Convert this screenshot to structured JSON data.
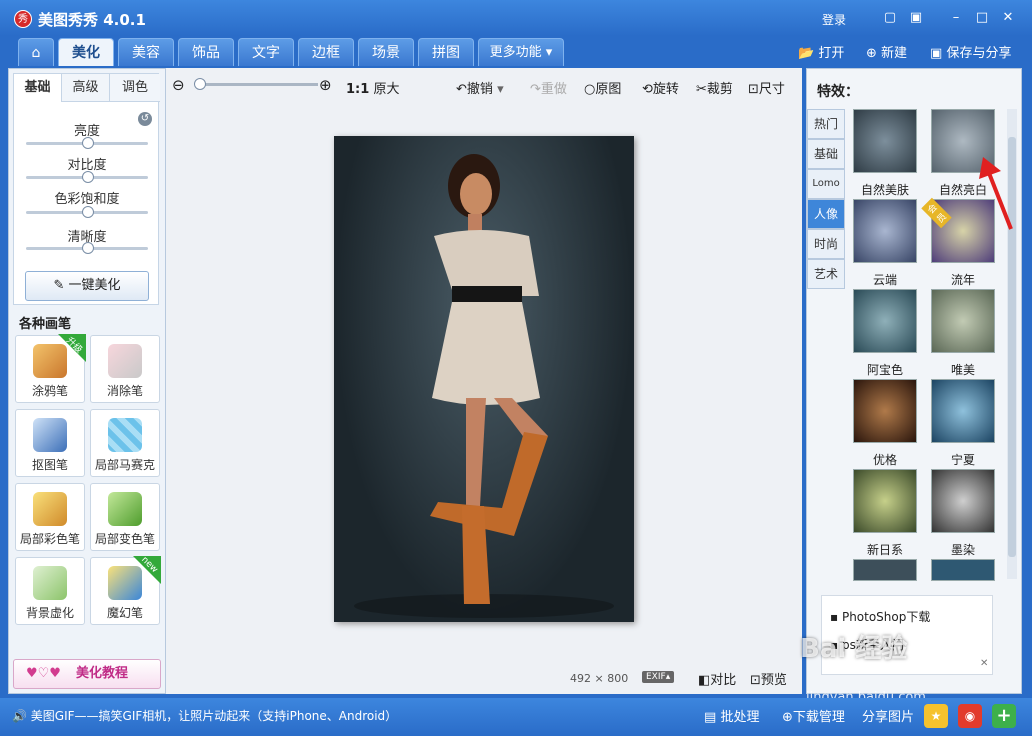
{
  "app": {
    "title": "美图秀秀 4.0.1",
    "logo_text": "秀",
    "login": "登录"
  },
  "tabs": [
    "美化",
    "美容",
    "饰品",
    "文字",
    "边框",
    "场景",
    "拼图",
    "更多功能"
  ],
  "file_actions": {
    "open": "打开",
    "new": "新建",
    "save_share": "保存与分享"
  },
  "adjust": {
    "subtabs": [
      "基础",
      "高级",
      "调色"
    ],
    "sliders": [
      "亮度",
      "对比度",
      "色彩饱和度",
      "清晰度"
    ],
    "onekey": "一键美化"
  },
  "brushes": {
    "title": "各种画笔",
    "items": [
      {
        "label": "涂鸦笔",
        "badge": "升级",
        "icon": "brush-icon"
      },
      {
        "label": "消除笔",
        "badge": "",
        "icon": "eraser-icon"
      },
      {
        "label": "抠图笔",
        "badge": "",
        "icon": "pen-icon"
      },
      {
        "label": "局部马赛克",
        "badge": "",
        "icon": "mosaic-icon"
      },
      {
        "label": "局部彩色笔",
        "badge": "",
        "icon": "color-brush-icon"
      },
      {
        "label": "局部变色笔",
        "badge": "",
        "icon": "recolor-icon"
      },
      {
        "label": "背景虚化",
        "badge": "",
        "icon": "blur-icon"
      },
      {
        "label": "魔幻笔",
        "badge": "new",
        "icon": "magic-pen-icon"
      }
    ]
  },
  "tutorial": "美化教程",
  "canvas_toolbar": {
    "ratio": "1:1",
    "original_size": "原大",
    "undo": "撤销",
    "redo": "重做",
    "original": "原图",
    "rotate": "旋转",
    "crop": "裁剪",
    "resize": "尺寸"
  },
  "image_info": {
    "width": "492",
    "times": "×",
    "height": "800",
    "exif": "EXIF",
    "compare": "对比",
    "preview": "预览"
  },
  "effects": {
    "label": "特效：",
    "categories": [
      "热门",
      "基础",
      "Lomo",
      "人像",
      "时尚",
      "艺术"
    ],
    "active_category": "人像",
    "items": [
      {
        "name": "自然美肤",
        "tone": "#3a4a55"
      },
      {
        "name": "自然亮白",
        "tone": "#6a7884"
      },
      {
        "name": "云端",
        "tone": "#4a5a78"
      },
      {
        "name": "流年",
        "tone": "#6b5c8c",
        "badge": "会员"
      },
      {
        "name": "阿宝色",
        "tone": "#3c5a66"
      },
      {
        "name": "唯美",
        "tone": "#6d7a6a"
      },
      {
        "name": "优格",
        "tone": "#4a2e22"
      },
      {
        "name": "宁夏",
        "tone": "#2c6080"
      },
      {
        "name": "新日系",
        "tone": "#6a7a44"
      },
      {
        "name": "墨染",
        "tone": "#555555"
      }
    ]
  },
  "ads": [
    "PhotoShop下载",
    "ps新手入门"
  ],
  "status": {
    "marquee": "美图GIF——搞笑GIF相机，让照片动起来（支持iPhone、Android）",
    "batch": "批处理",
    "download": "下载管理",
    "share": "分享图片"
  },
  "watermark": {
    "line1": "Bai 经验",
    "line2": "jingyan.baidu.com"
  }
}
